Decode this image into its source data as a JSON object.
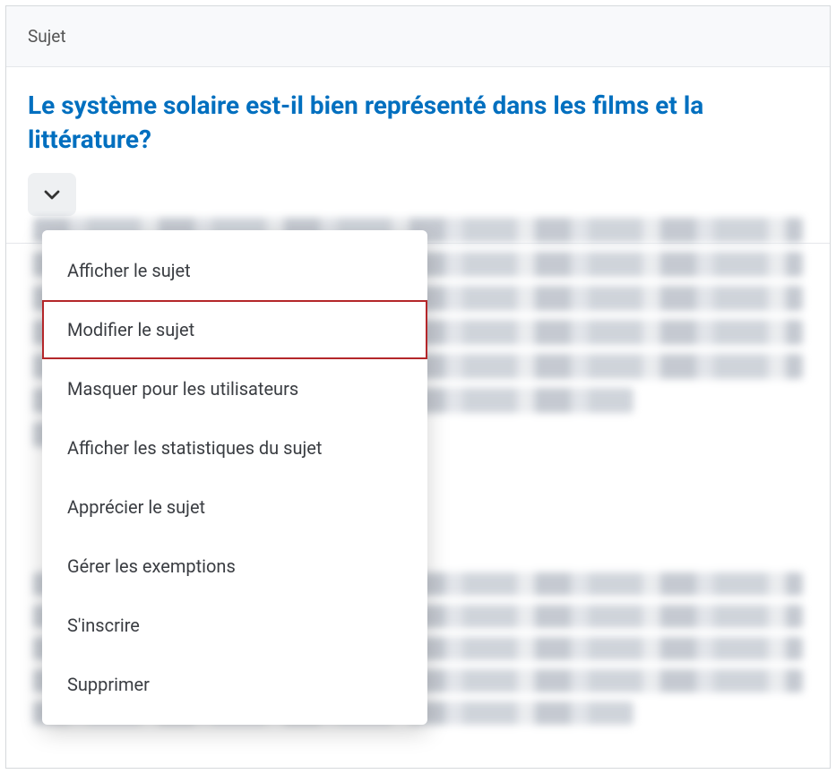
{
  "header": {
    "label": "Sujet"
  },
  "topic": {
    "title": "Le système solaire est-il bien représenté dans les films et la littérature?"
  },
  "dropdown": {
    "items": [
      {
        "label": "Afficher le sujet"
      },
      {
        "label": "Modifier le sujet"
      },
      {
        "label": "Masquer pour les utilisateurs"
      },
      {
        "label": "Afficher les statistiques du sujet"
      },
      {
        "label": "Apprécier le sujet"
      },
      {
        "label": "Gérer les exemptions"
      },
      {
        "label": "S'inscrire"
      },
      {
        "label": "Supprimer"
      }
    ],
    "highlight_index": 1
  }
}
